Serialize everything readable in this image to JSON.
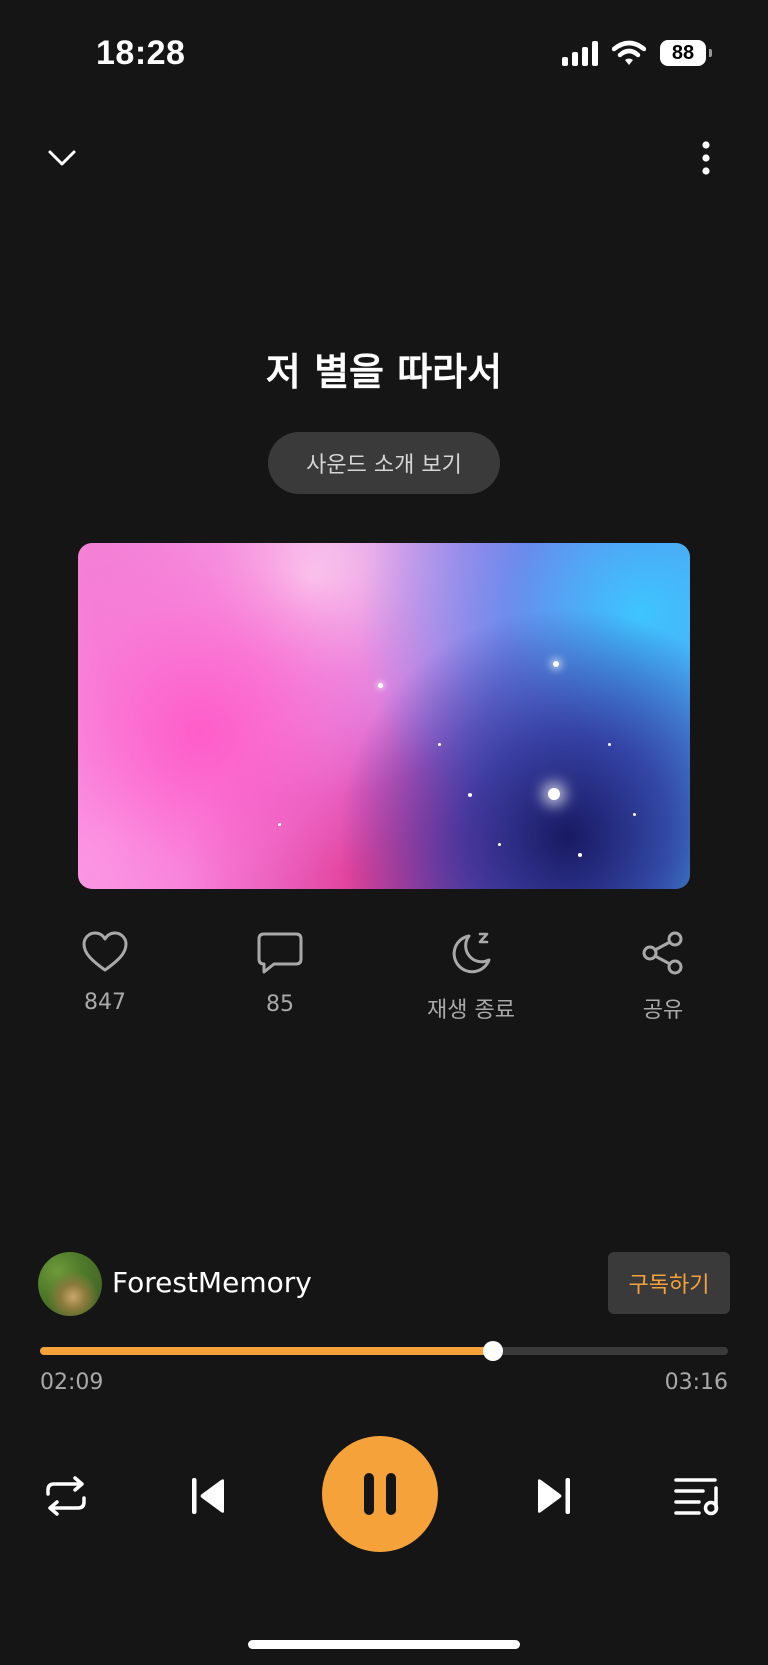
{
  "status_bar": {
    "time": "18:28",
    "battery": "88",
    "icons": [
      "signal-icon",
      "wifi-icon",
      "battery-icon"
    ]
  },
  "top_nav": {
    "left_icon": "chevron-down-icon",
    "right_icon": "more-vertical-icon"
  },
  "track": {
    "title": "저 별을 따라서",
    "intro_button_label": "사운드 소개 보기",
    "artwork_description_icon": "cover-art"
  },
  "actions": [
    {
      "name": "like",
      "icon": "heart-icon",
      "label": "847"
    },
    {
      "name": "comments",
      "icon": "comment-icon",
      "label": "85"
    },
    {
      "name": "sleep-timer",
      "icon": "moon-icon",
      "label": "재생 종료"
    },
    {
      "name": "share",
      "icon": "share-icon",
      "label": "공유"
    }
  ],
  "channel": {
    "name": "ForestMemory",
    "subscribe_label": "구독하기"
  },
  "progress": {
    "current_time": "02:09",
    "total_time": "03:16",
    "fraction": 0.658
  },
  "controls": {
    "repeat_icon": "repeat-icon",
    "previous_icon": "skip-previous-icon",
    "play_state_icon": "pause-icon",
    "next_icon": "skip-next-icon",
    "playlist_icon": "playlist-icon"
  },
  "colors": {
    "background": "#151515",
    "accent": "#f5a23a",
    "secondary_text": "#a9a9a9",
    "chip": "#3a3a3a"
  }
}
